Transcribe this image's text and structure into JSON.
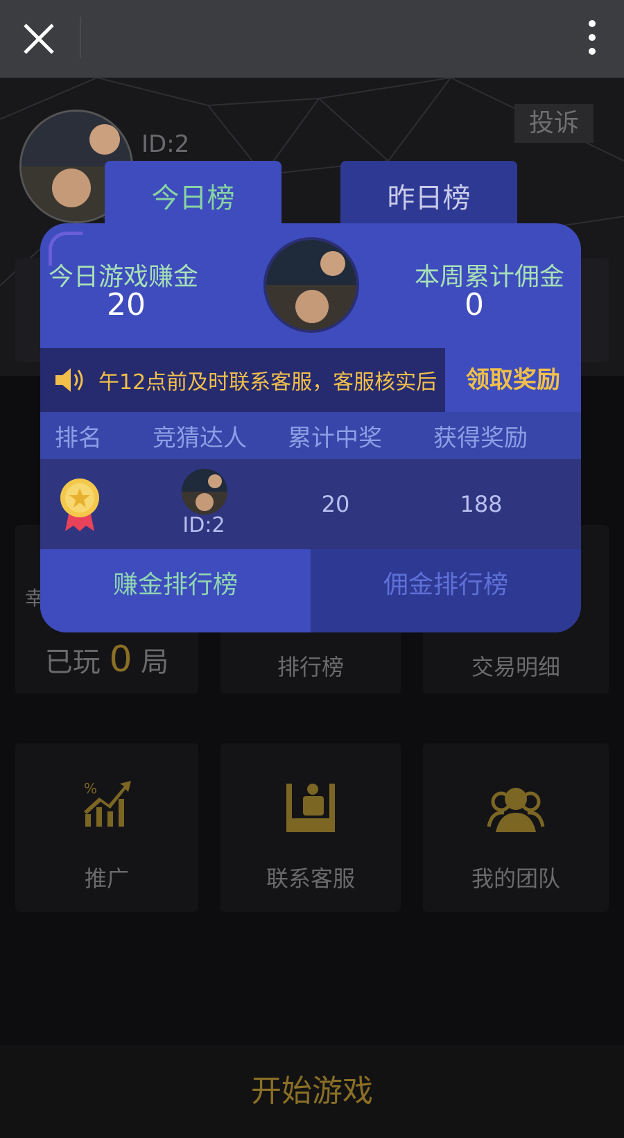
{
  "topbar": {
    "close_icon": "close-icon",
    "more_icon": "more-vertical-icon"
  },
  "background": {
    "user_id": "ID:2",
    "complain": "投诉",
    "played_prefix": "已玩",
    "played_count": "0",
    "played_suffix": "局",
    "cards": {
      "lucky_partial": "幸",
      "ranking": "排行榜",
      "transactions": "交易明细",
      "promote": "推广",
      "contact": "联系客服",
      "team": "我的团队"
    },
    "start_game": "开始游戏"
  },
  "modal": {
    "tabs": {
      "today": "今日榜",
      "yesterday": "昨日榜"
    },
    "today_earn_label": "今日游戏赚金",
    "today_earn_value": "20",
    "week_comm_label": "本周累计佣金",
    "week_comm_value": "0",
    "notice": "午12点前及时联系客服，客服核实后",
    "claim_button": "领取奖励",
    "table": {
      "headers": [
        "排名",
        "竞猜达人",
        "累计中奖",
        "获得奖励"
      ],
      "rows": [
        {
          "rank_icon": "gold-medal-icon",
          "user_id": "ID:2",
          "total_win": "20",
          "reward": "188"
        }
      ]
    },
    "bottom_tabs": {
      "earn": "赚金排行榜",
      "commission": "佣金排行榜"
    }
  },
  "colors": {
    "modal_bg": "#3e4cbd",
    "accent_gold": "#f1c04a",
    "green_text": "#a7e0b7"
  }
}
